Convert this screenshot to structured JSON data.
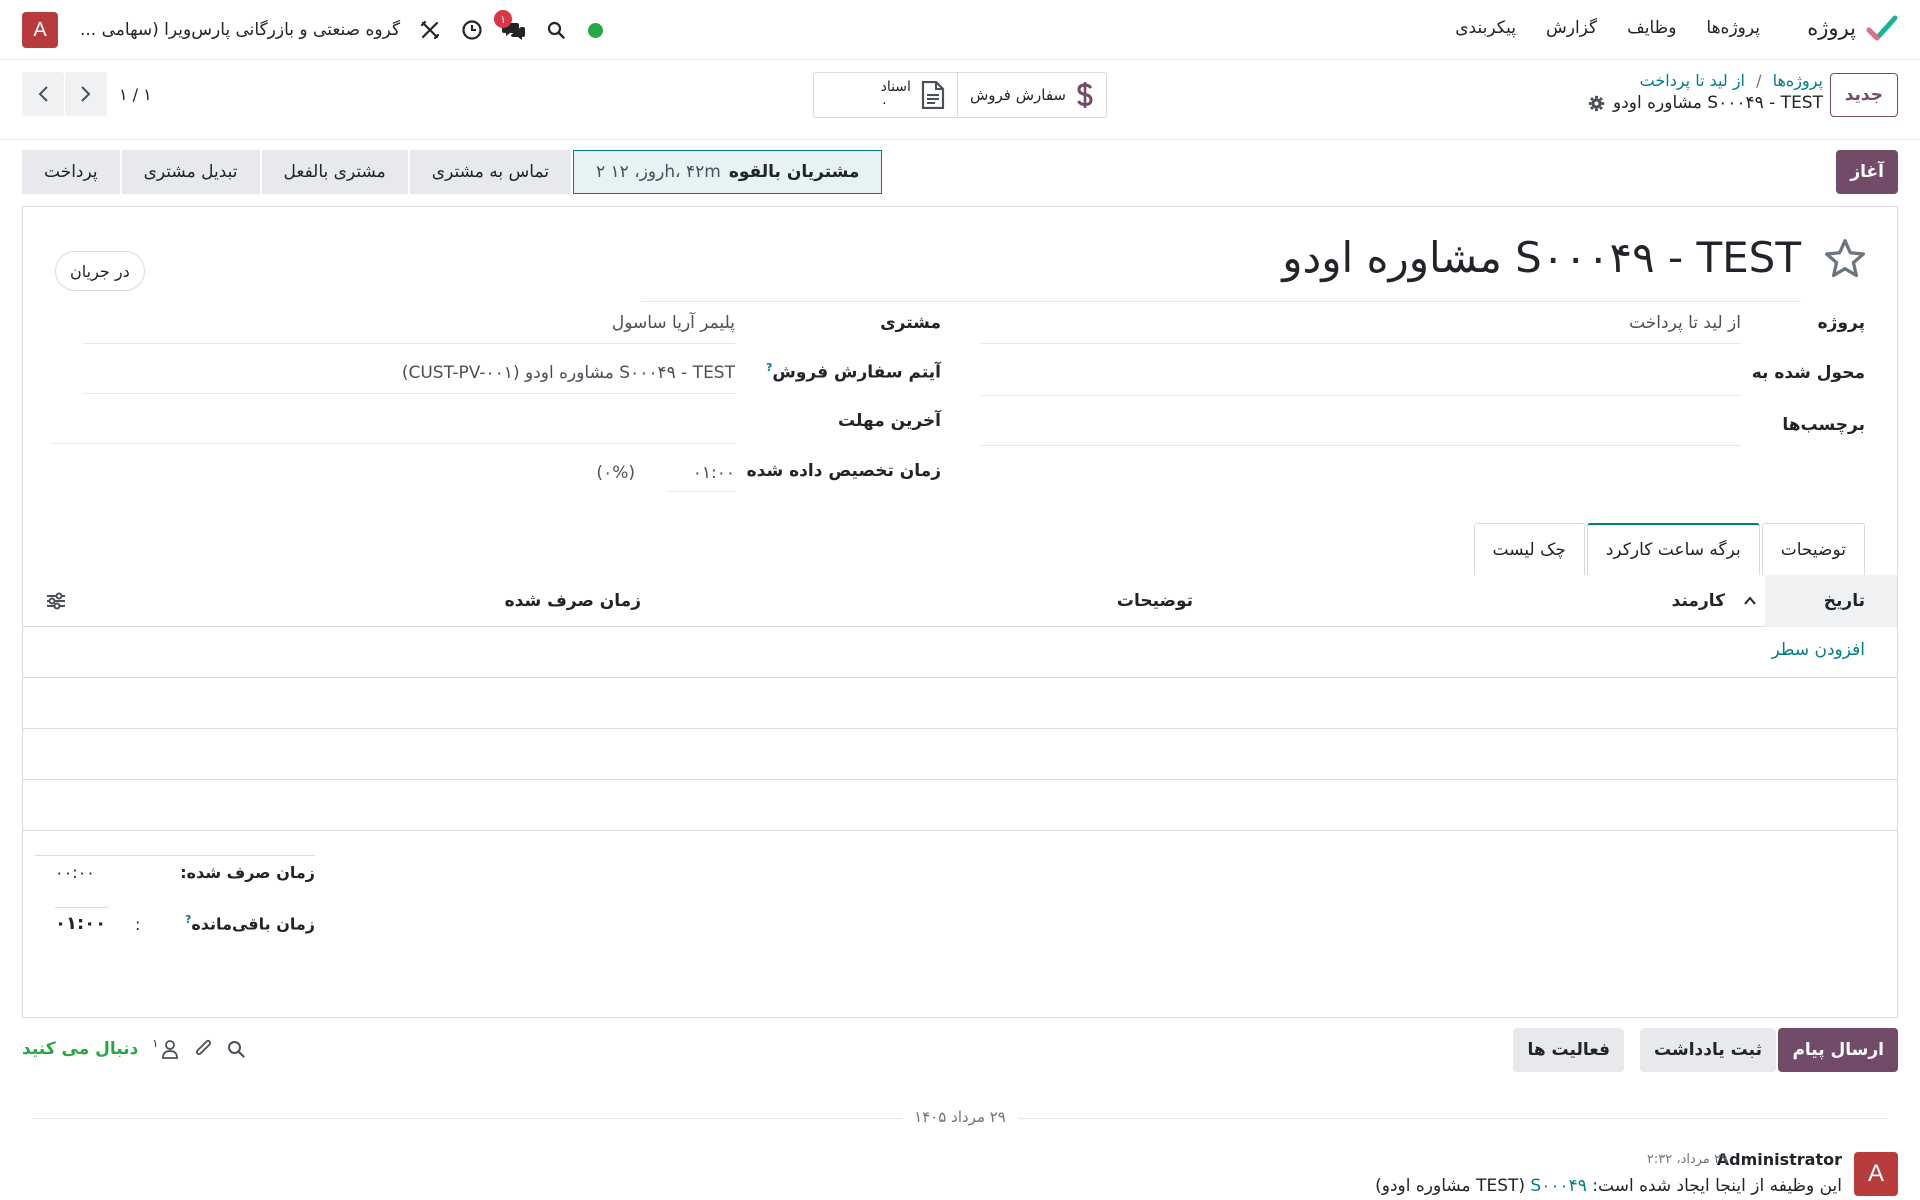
{
  "navbar": {
    "app_name": "پروژه",
    "menu": [
      "پروژه‌ها",
      "وظایف",
      "گزارش",
      "پیکربندی"
    ],
    "company": "گروه صنعتی و بازرگانی پارس‌ویرا (سهامی ...",
    "user_initial": "A",
    "chat_badge": "۱"
  },
  "control": {
    "new_label": "جدید",
    "crumb_projects": "پروژه‌ها",
    "crumb_sep": "/",
    "crumb_pipeline": "از لید تا پرداخت",
    "current": "S۰۰۰۴۹ - TEST مشاوره اودو",
    "smart_sale": "سفارش فروش",
    "smart_docs_label": "اسناد",
    "smart_docs_count": "۰",
    "pager": "۱ / ۱"
  },
  "statusbar": {
    "start_label": "آغاز",
    "stages": [
      {
        "label": "پرداخت"
      },
      {
        "label": "تبدیل مشتری"
      },
      {
        "label": "مشتری بالفعل"
      },
      {
        "label": "تماس به مشتری"
      },
      {
        "label": "مشتریان بالقوه",
        "sub": "۲ روز، ۱۲h، ۴۲m"
      }
    ]
  },
  "form": {
    "title": "S۰۰۰۴۹ - TEST مشاوره اودو",
    "status": "در جریان",
    "project_label": "پروژه",
    "project_value": "از لید تا پرداخت",
    "assignee_label": "محول شده به",
    "tags_label": "برچسب‌ها",
    "customer_label": "مشتری",
    "customer_value": "پلیمر آریا ساسول",
    "so_item_label": "آیتم سفارش فروش",
    "so_item_value": "S۰۰۰۴۹ - TEST مشاوره اودو (CUST-PV-۰۰۱)",
    "deadline_label": "آخرین مهلت",
    "allocated_label": "زمان تخصیص داده شده",
    "allocated_value": "۰۱:۰۰",
    "allocated_pct": "(۰%)",
    "help_mark": "?"
  },
  "tabs": [
    "توضیحات",
    "برگه ساعت کارکرد",
    "چک لیست"
  ],
  "timesheet": {
    "columns": {
      "date": "تاریخ",
      "employee": "کارمند",
      "description": "توضیحات",
      "spent": "زمان صرف شده"
    },
    "add_line": "افزودن سطر",
    "spent_label": "زمان صرف شده:",
    "spent_value": "۰۰:۰۰",
    "remaining_label": "زمان باقی‌مانده",
    "remaining_colon": ":",
    "remaining_value": "۰۱:۰۰"
  },
  "chatter": {
    "send_label": "ارسال پیام",
    "note_label": "ثبت یادداشت",
    "activities_label": "فعالیت ها",
    "followers_count": "۱",
    "follow_label": "دنبال می کنید",
    "date_separator": "۲۹ مرداد ۱۴۰۵",
    "message": {
      "author": "Administrator",
      "when": "۲۹ مرداد، ۲:۳۲",
      "body_prefix": "این وظیفه از اینجا ایجاد شده است:",
      "link": "S۰۰۰۴۹",
      "body_suffix": "(TEST مشاوره اودو)"
    }
  },
  "colors": {
    "primary": "#714b67",
    "link": "#017e84",
    "follow": "#28a745",
    "avatar": "#b83c3c"
  }
}
